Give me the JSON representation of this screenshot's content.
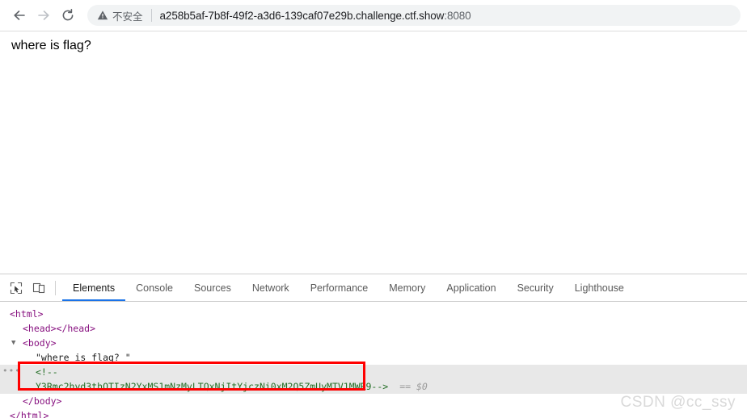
{
  "browser": {
    "nav": {
      "back_label": "Back",
      "forward_label": "Forward",
      "reload_label": "Reload"
    },
    "omnibox": {
      "security_text": "不安全",
      "security_icon": "warning-triangle-icon",
      "url_main": "a258b5af-7b8f-49f2-a3d6-139caf07e29b.challenge.ctf.show",
      "url_port": ":8080"
    }
  },
  "page": {
    "body_text": "where is flag?"
  },
  "devtools": {
    "toolbar": {
      "inspect_icon": "inspect-element-icon",
      "device_icon": "device-toolbar-icon"
    },
    "tabs": [
      {
        "label": "Elements",
        "active": true
      },
      {
        "label": "Console",
        "active": false
      },
      {
        "label": "Sources",
        "active": false
      },
      {
        "label": "Network",
        "active": false
      },
      {
        "label": "Performance",
        "active": false
      },
      {
        "label": "Memory",
        "active": false
      },
      {
        "label": "Application",
        "active": false
      },
      {
        "label": "Security",
        "active": false
      },
      {
        "label": "Lighthouse",
        "active": false
      }
    ],
    "dom": {
      "row_html_open": "<html>",
      "row_head": "<head></head>",
      "row_body_open": "<body>",
      "row_text_node": "\"where is flag? \"",
      "row_comment_open": "<!--",
      "row_comment_value": "Y3Rmc2hvd3thOTIzN2YxMS1mNzMyLTQxNjItYjczNi0xM2Q5ZmUyMTV1MWR9-->",
      "row_selected_marker": "== $0",
      "row_body_close": "</body>",
      "row_html_close": "</html>",
      "gutter_dots": "•••",
      "triangle_expanded": "▼"
    }
  },
  "watermark": {
    "text": "CSDN @cc_ssy"
  },
  "colors": {
    "accent": "#1a73e8",
    "annotation": "#ff0000",
    "tag": "#881280",
    "comment": "#236e25"
  }
}
